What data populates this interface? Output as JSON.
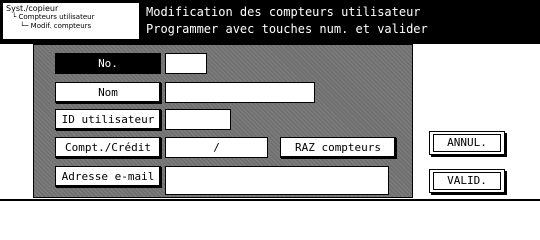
{
  "breadcrumb": {
    "level1": "Syst./copieur",
    "level2": "Compteurs utilisateur",
    "level3": "Modif. compteurs"
  },
  "header": {
    "title": "Modification des compteurs utilisateur",
    "instruction": "Programmer avec touches num. et valider"
  },
  "form": {
    "no_label": "No.",
    "no_value": "",
    "nom_label": "Nom",
    "nom_value": "",
    "id_label": "ID utilisateur",
    "id_value": "",
    "compt_label": "Compt./Crédit",
    "compt_value": "/",
    "raz_label": "RAZ compteurs",
    "email_label": "Adresse e-mail",
    "email_value": ""
  },
  "actions": {
    "cancel_label": "ANNUL.",
    "validate_label": "VALID."
  }
}
